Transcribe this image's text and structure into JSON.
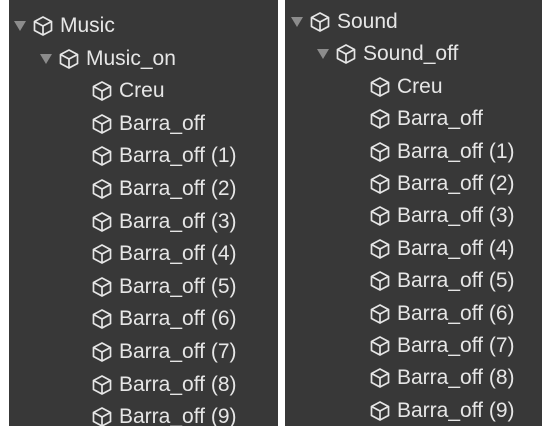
{
  "colors": {
    "panel_bg": "#383838",
    "text": "#e6e6e6",
    "arrow": "#8c8c8c",
    "icon": "#e6e6e6"
  },
  "icons": {
    "expand_arrow": "triangle-down-icon",
    "game_object": "cube-icon"
  },
  "hierarchies": [
    {
      "root": {
        "label": "Music",
        "expanded": true
      },
      "group": {
        "label": "Music_on",
        "expanded": true
      },
      "items": [
        "Creu",
        "Barra_off",
        "Barra_off (1)",
        "Barra_off (2)",
        "Barra_off (3)",
        "Barra_off (4)",
        "Barra_off (5)",
        "Barra_off (6)",
        "Barra_off (7)",
        "Barra_off (8)",
        "Barra_off (9)"
      ]
    },
    {
      "root": {
        "label": "Sound",
        "expanded": true
      },
      "group": {
        "label": "Sound_off",
        "expanded": true
      },
      "items": [
        "Creu",
        "Barra_off",
        "Barra_off (1)",
        "Barra_off (2)",
        "Barra_off (3)",
        "Barra_off (4)",
        "Barra_off (5)",
        "Barra_off (6)",
        "Barra_off (7)",
        "Barra_off (8)",
        "Barra_off (9)"
      ]
    }
  ]
}
